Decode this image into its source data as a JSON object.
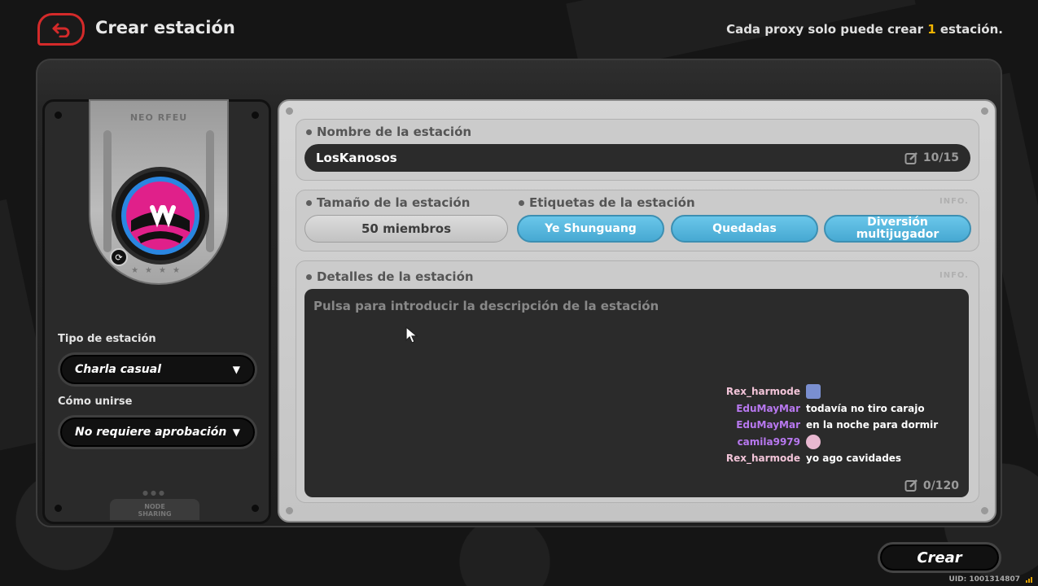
{
  "header": {
    "title": "Crear estación",
    "proxy_note_before": "Cada proxy solo puede crear ",
    "proxy_note_num": "1",
    "proxy_note_after": " estación."
  },
  "left_panel": {
    "badge_stamp": "NEO RFEU",
    "station_type_label": "Tipo de estación",
    "station_type_value": "Charla casual",
    "join_label": "Cómo unirse",
    "join_value": "No requiere aprobación",
    "footer_label_1": "NODE",
    "footer_label_2": "SHARING"
  },
  "name_section": {
    "title": "Nombre de la estación",
    "value": "LosKanosos",
    "counter": "10/15"
  },
  "size_section": {
    "title": "Tamaño de la estación",
    "value": "50 miembros"
  },
  "tags_section": {
    "title": "Etiquetas de la estación",
    "info": "INFO.",
    "tags": [
      "Ye Shunguang",
      "Quedadas",
      "Diversión multijugador"
    ]
  },
  "details_section": {
    "title": "Detalles de la estación",
    "info": "INFO.",
    "placeholder": "Pulsa para introducir la descripción de la estación",
    "counter": "0/120"
  },
  "chat": [
    {
      "user": "Rex_harmode",
      "msg": "",
      "color": "#f2c4d8",
      "emote": "#7a8fd0"
    },
    {
      "user": "EduMayMar",
      "msg": "todavía no tiro carajo",
      "color": "#b878f0",
      "emote": ""
    },
    {
      "user": "EduMayMar",
      "msg": "en la noche para dormir",
      "color": "#b878f0",
      "emote": ""
    },
    {
      "user": "camila9979",
      "msg": "",
      "color": "#b878f0",
      "emote": "#e8b8d0"
    },
    {
      "user": "Rex_harmode",
      "msg": "yo ago cavidades",
      "color": "#f2c4d8",
      "emote": ""
    }
  ],
  "footer": {
    "create_label": "Crear",
    "uid": "UID: 1001314807"
  },
  "colors": {
    "accent_red": "#d42a2a",
    "tag_blue": "#52b4dd",
    "highlight_yellow": "#f2b400",
    "avatar_pink": "#e0208a",
    "avatar_blue": "#2a86e0"
  }
}
